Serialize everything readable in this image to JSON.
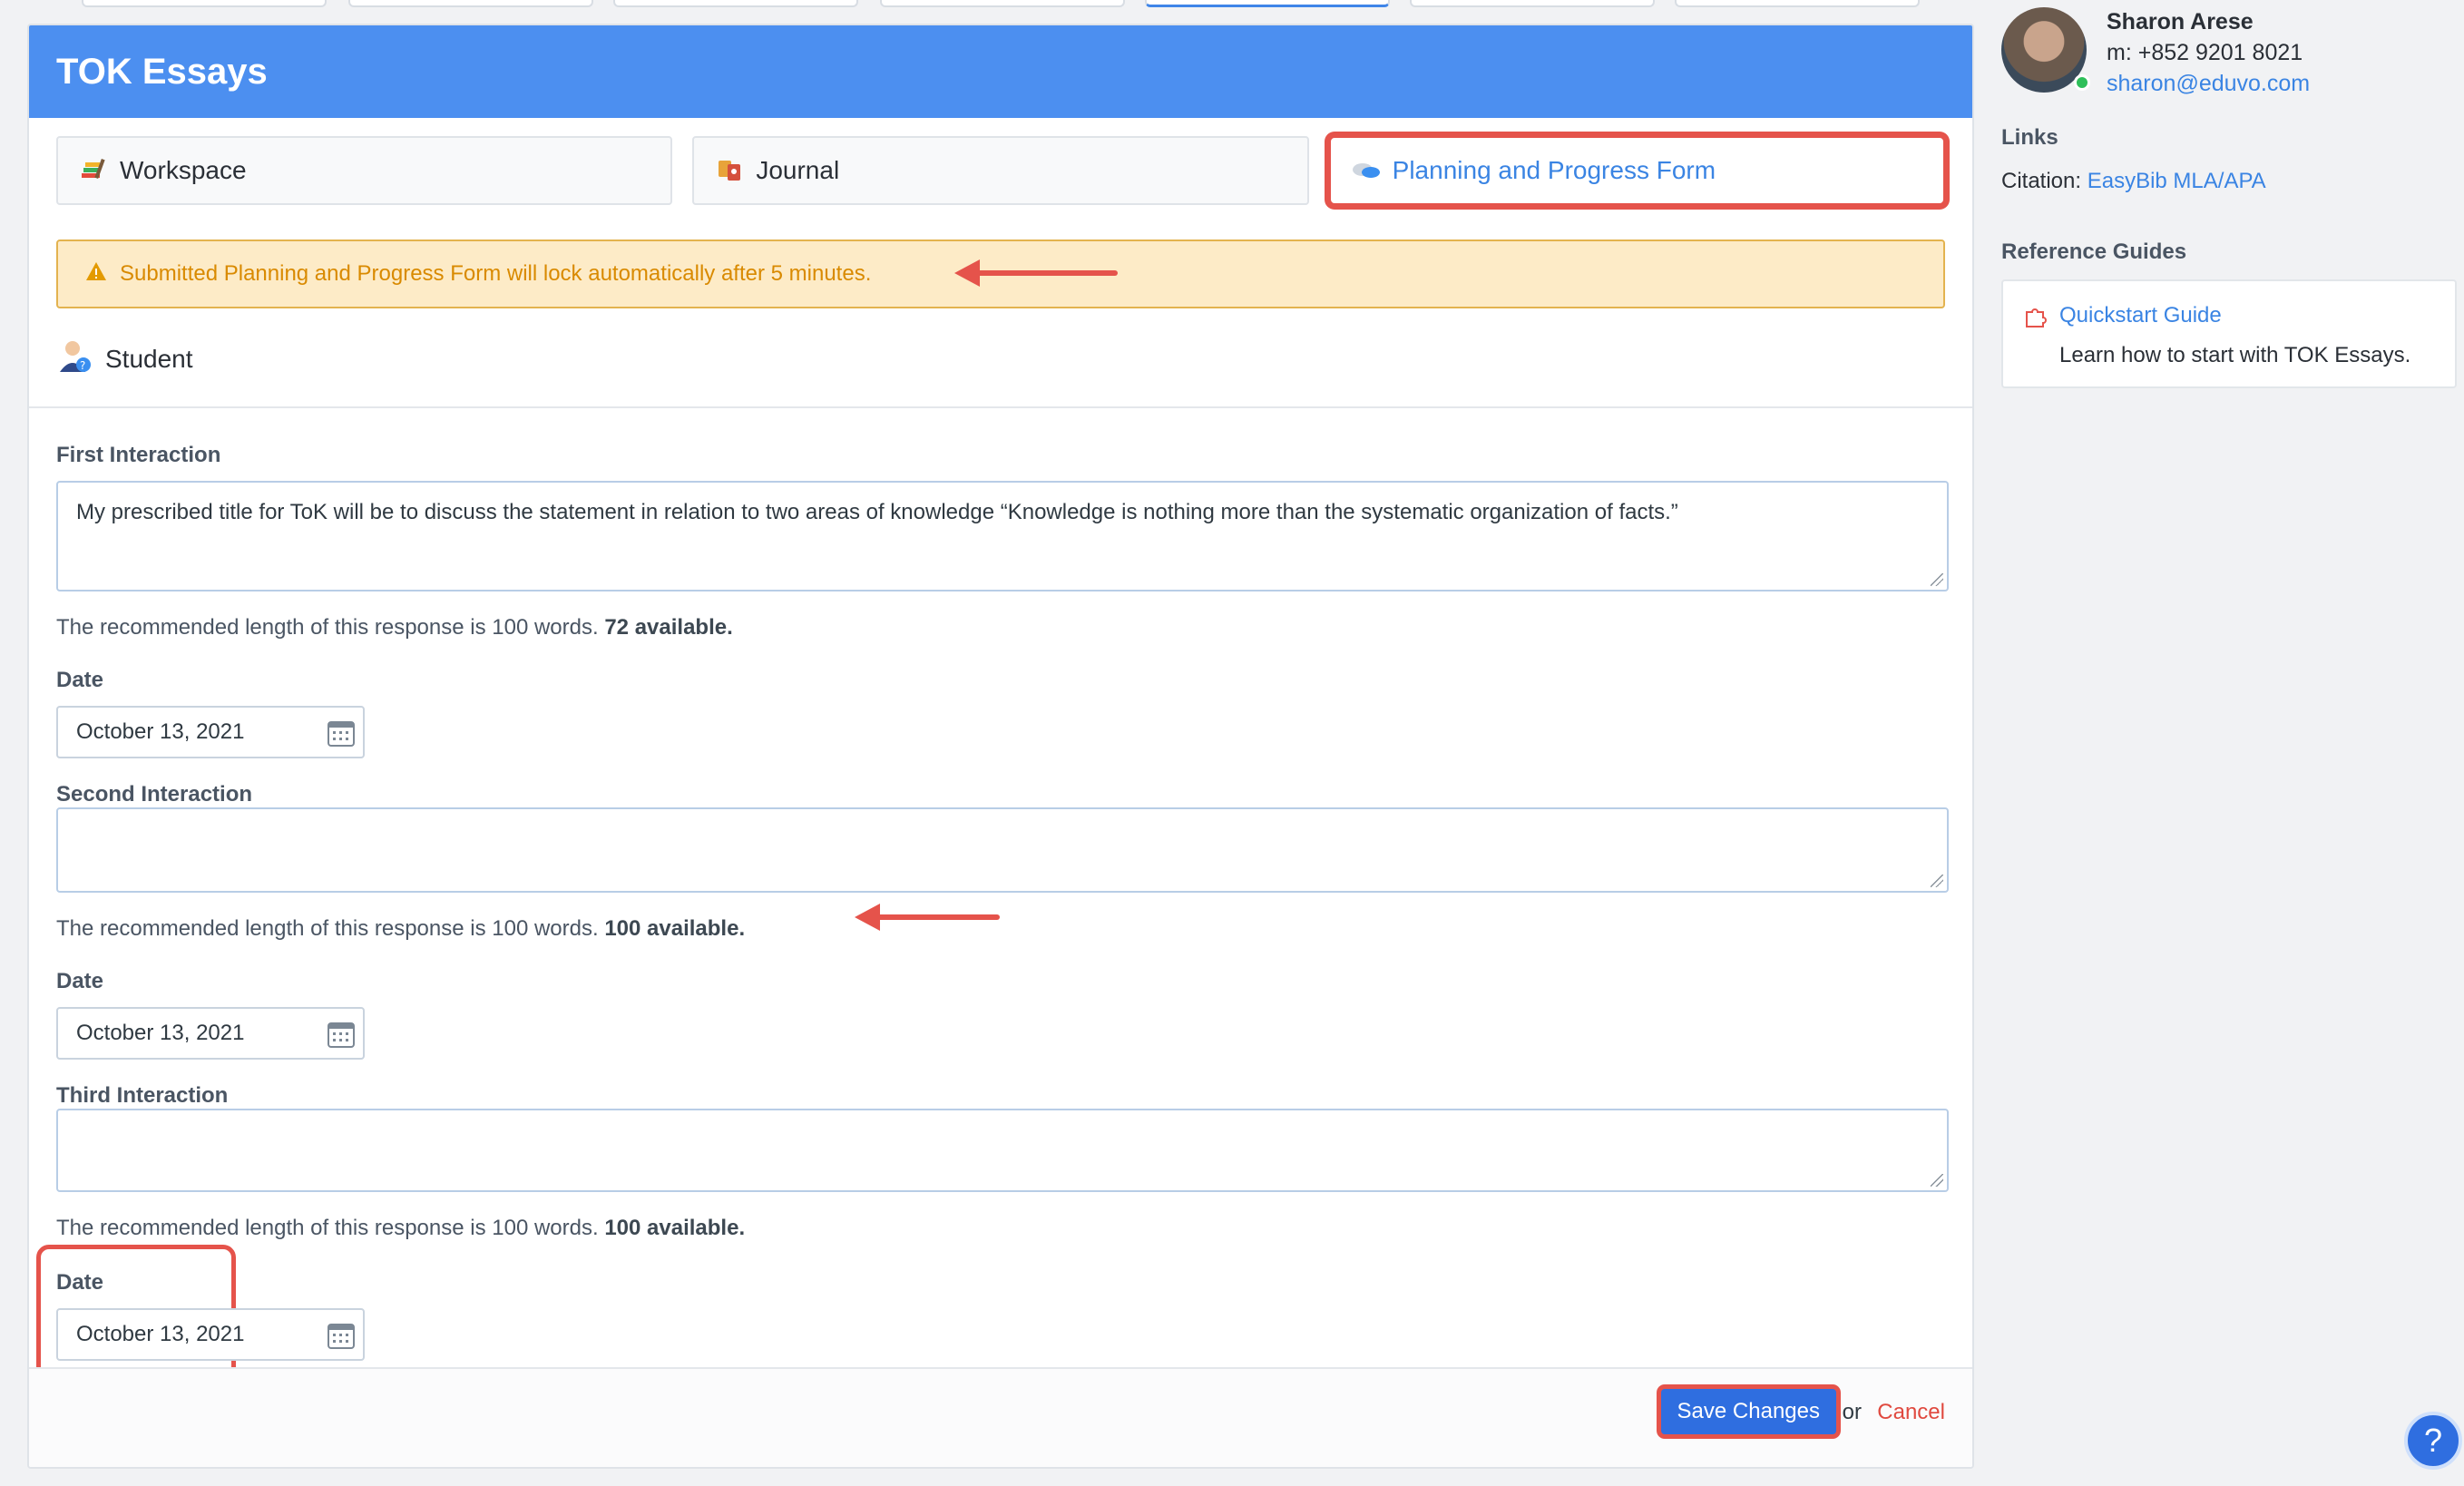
{
  "header": {
    "title": "TOK Essays"
  },
  "tabs": [
    {
      "label": "Workspace",
      "icon": "workspace-icon"
    },
    {
      "label": "Journal",
      "icon": "journal-icon"
    },
    {
      "label": "Planning and Progress Form",
      "icon": "chat-bubbles-icon",
      "selected": true
    }
  ],
  "alert": {
    "text": "Submitted Planning and Progress Form will lock automatically after 5 minutes.",
    "icon": "warning-icon"
  },
  "section": {
    "title": "Student",
    "icon": "student-icon"
  },
  "interactions": [
    {
      "label": "First Interaction",
      "value": "My prescribed title for ToK will be to discuss the statement in relation to two areas of knowledge “Knowledge is nothing more than the systematic organization of facts.”",
      "hint": "The recommended length of this response is 100 words.",
      "available": "72 available.",
      "date_label": "Date",
      "date": "October 13, 2021"
    },
    {
      "label": "Second Interaction",
      "value": "",
      "hint": "The recommended length of this response is 100 words.",
      "available": "100 available.",
      "date_label": "Date",
      "date": "October 13, 2021"
    },
    {
      "label": "Third Interaction",
      "value": "",
      "hint": "The recommended length of this response is 100 words.",
      "available": "100 available.",
      "date_label": "Date",
      "date": "October 13, 2021"
    }
  ],
  "footer": {
    "save_label": "Save Changes",
    "or_text": "or",
    "cancel_label": "Cancel"
  },
  "profile": {
    "name": "Sharon Arese",
    "phone": "m: +852 9201 8021",
    "email": "sharon@eduvo.com"
  },
  "links": {
    "heading": "Links",
    "citation_label": "Citation:",
    "citation_link": "EasyBib MLA/APA"
  },
  "guides": {
    "heading": "Reference Guides",
    "title": "Quickstart Guide",
    "description": "Learn how to start with TOK Essays."
  },
  "colors": {
    "brand": "#4c8ff0",
    "accent": "#3a84e3",
    "annotation": "#e5534b",
    "warning": "#d98a00"
  }
}
